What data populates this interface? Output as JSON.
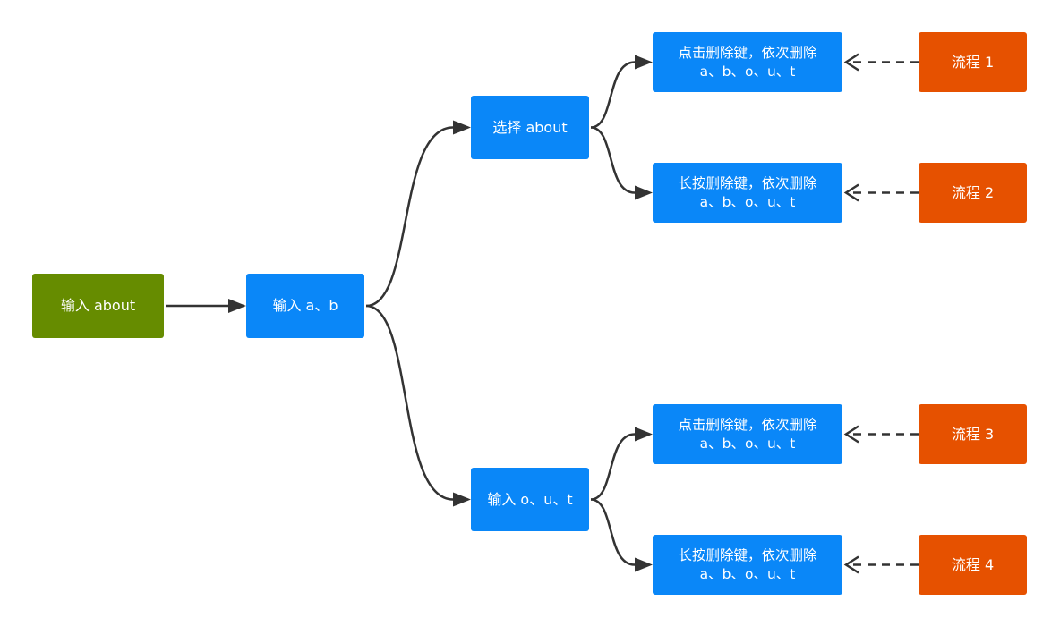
{
  "colors": {
    "start": "#668c00",
    "step": "#0a87f8",
    "flow": "#e65100",
    "edge": "#333333"
  },
  "nodes": {
    "start": {
      "label": "输入 about"
    },
    "input_ab": {
      "label": "输入 a、b"
    },
    "select_about": {
      "label": "选择 about"
    },
    "input_out": {
      "label": "输入 o、u、t"
    },
    "leaf1": {
      "line1": "点击删除键，依次删除",
      "line2": "a、b、o、u、t"
    },
    "leaf2": {
      "line1": "长按删除键，依次删除",
      "line2": "a、b、o、u、t"
    },
    "leaf3": {
      "line1": "点击删除键，依次删除",
      "line2": "a、b、o、u、t"
    },
    "leaf4": {
      "line1": "长按删除键，依次删除",
      "line2": "a、b、o、u、t"
    },
    "flow1": {
      "label": "流程 1"
    },
    "flow2": {
      "label": "流程 2"
    },
    "flow3": {
      "label": "流程 3"
    },
    "flow4": {
      "label": "流程 4"
    }
  },
  "edges": [
    {
      "from": "start",
      "to": "input_ab",
      "style": "solid"
    },
    {
      "from": "input_ab",
      "to": "select_about",
      "style": "solid"
    },
    {
      "from": "input_ab",
      "to": "input_out",
      "style": "solid"
    },
    {
      "from": "select_about",
      "to": "leaf1",
      "style": "solid"
    },
    {
      "from": "select_about",
      "to": "leaf2",
      "style": "solid"
    },
    {
      "from": "input_out",
      "to": "leaf3",
      "style": "solid"
    },
    {
      "from": "input_out",
      "to": "leaf4",
      "style": "solid"
    },
    {
      "from": "flow1",
      "to": "leaf1",
      "style": "dashed"
    },
    {
      "from": "flow2",
      "to": "leaf2",
      "style": "dashed"
    },
    {
      "from": "flow3",
      "to": "leaf3",
      "style": "dashed"
    },
    {
      "from": "flow4",
      "to": "leaf4",
      "style": "dashed"
    }
  ]
}
